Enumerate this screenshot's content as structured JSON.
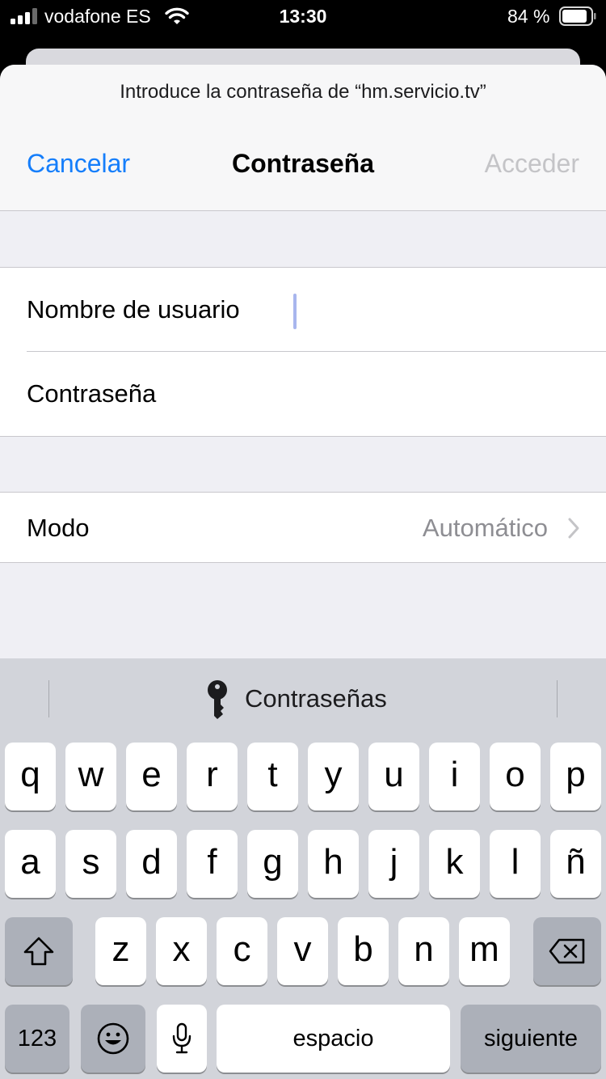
{
  "status_bar": {
    "carrier": "vodafone ES",
    "time": "13:30",
    "battery_percent": "84 %",
    "signal_bars_filled": 3,
    "signal_bars_total": 4,
    "battery_level": 0.84,
    "icons": [
      "signal-icon",
      "wifi-icon",
      "battery-icon"
    ]
  },
  "dialog": {
    "prompt": "Introduce la contraseña de “hm.servicio.tv”",
    "title": "Contraseña",
    "cancel_label": "Cancelar",
    "submit_label": "Acceder",
    "accent_color": "#157EFB",
    "disabled_color": "#C4C4C7"
  },
  "form": {
    "username_label": "Nombre de usuario",
    "username_value": "",
    "password_label": "Contraseña",
    "password_value": ""
  },
  "mode": {
    "label": "Modo",
    "value": "Automático",
    "icon": "chevron-right-icon"
  },
  "keyboard": {
    "suggestion": "Contraseñas",
    "suggestion_icon": "key-icon",
    "row1": [
      "q",
      "w",
      "e",
      "r",
      "t",
      "y",
      "u",
      "i",
      "o",
      "p"
    ],
    "row2": [
      "a",
      "s",
      "d",
      "f",
      "g",
      "h",
      "j",
      "k",
      "l",
      "ñ"
    ],
    "row3": [
      "z",
      "x",
      "c",
      "v",
      "b",
      "n",
      "m"
    ],
    "numbers_label": "123",
    "space_label": "espacio",
    "return_label": "siguiente",
    "icons": [
      "shift-icon",
      "delete-icon",
      "emoji-icon",
      "microphone-icon"
    ]
  }
}
